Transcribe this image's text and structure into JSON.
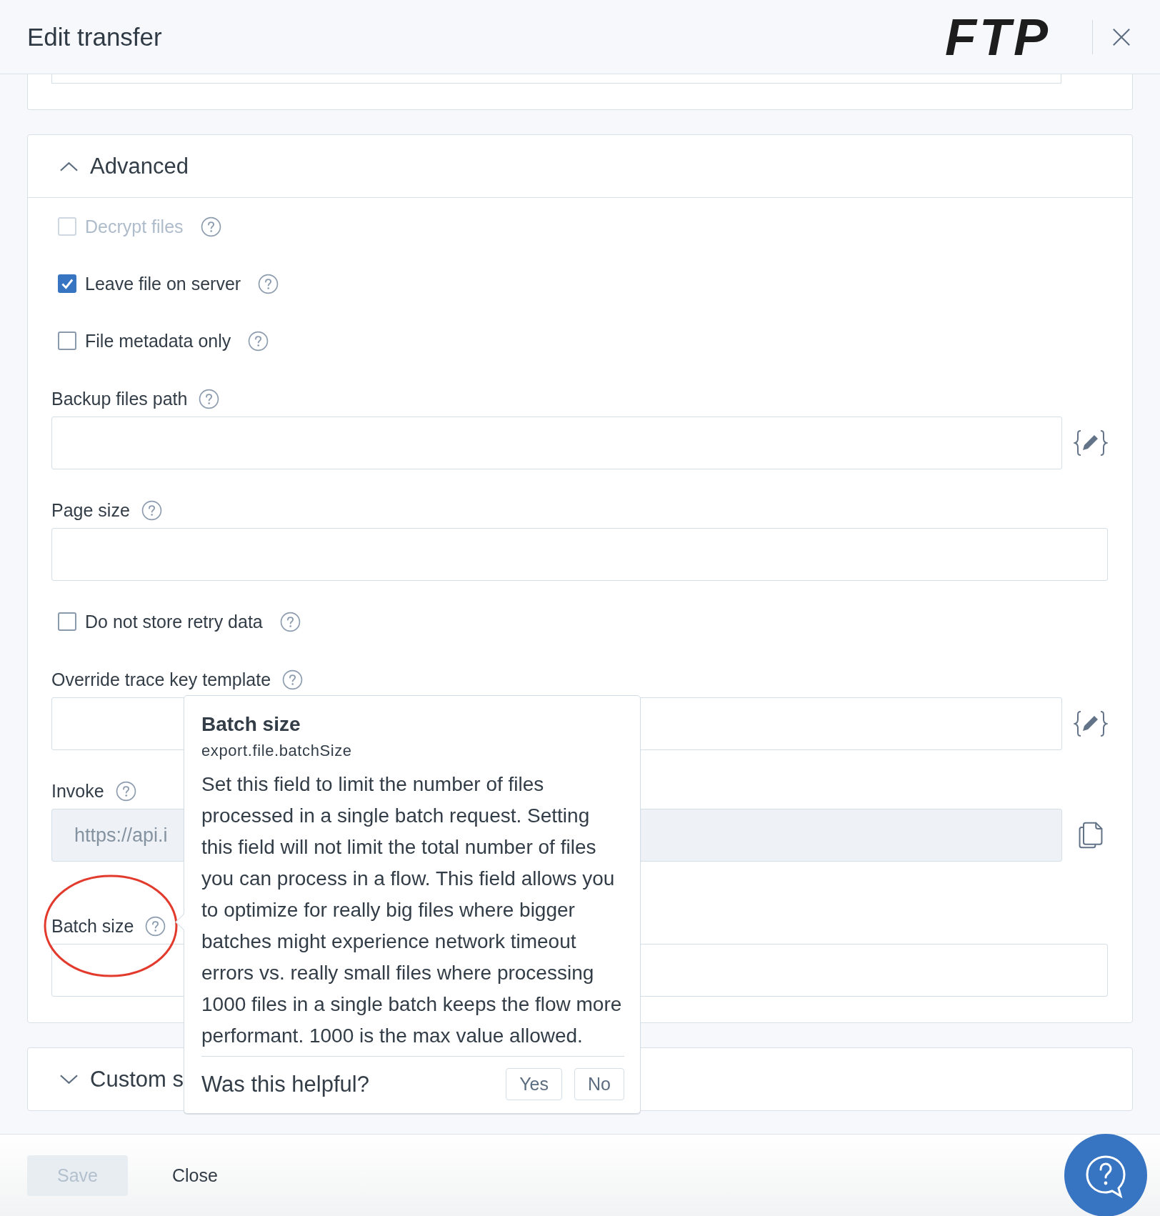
{
  "header": {
    "title": "Edit transfer",
    "logo": "FTP"
  },
  "advanced": {
    "title": "Advanced",
    "expanded": true,
    "fields": [
      {
        "kind": "checkbox",
        "label": "Decrypt files",
        "checked": false,
        "disabled": true
      },
      {
        "kind": "checkbox",
        "label": "Leave file on server",
        "checked": true,
        "disabled": false
      },
      {
        "kind": "checkbox",
        "label": "File metadata only",
        "checked": false,
        "disabled": false
      },
      {
        "kind": "text",
        "label": "Backup files path",
        "has_expression_button": true
      },
      {
        "kind": "text",
        "label": "Page size"
      },
      {
        "kind": "checkbox",
        "label": "Do not store retry data",
        "checked": false,
        "disabled": false
      },
      {
        "kind": "text",
        "label": "Override trace key template",
        "has_expression_button": true
      },
      {
        "kind": "readonly",
        "label": "Invoke",
        "value": "https://api.i",
        "has_copy_button": true
      },
      {
        "kind": "text",
        "label": "Batch size",
        "highlighted": true
      }
    ]
  },
  "custom": {
    "title": "Custom s",
    "expanded": false
  },
  "tooltip": {
    "title": "Batch size",
    "path": "export.file.batchSize",
    "body": "Set this field to limit the number of files processed in a single batch request. Setting this field will not limit the total number of files you can process in a flow. This field allows you to optimize for really big files where bigger batches might experience network timeout errors vs. really small files where processing 1000 files in a single batch keeps the flow more performant. 1000 is the max value allowed.",
    "question": "Was this helpful?",
    "buttons": [
      "Yes",
      "No"
    ]
  },
  "footer": {
    "buttons": [
      {
        "kind": "primary",
        "label": "Save",
        "disabled": true
      },
      {
        "kind": "text",
        "label": "Close",
        "disabled": false
      }
    ]
  }
}
